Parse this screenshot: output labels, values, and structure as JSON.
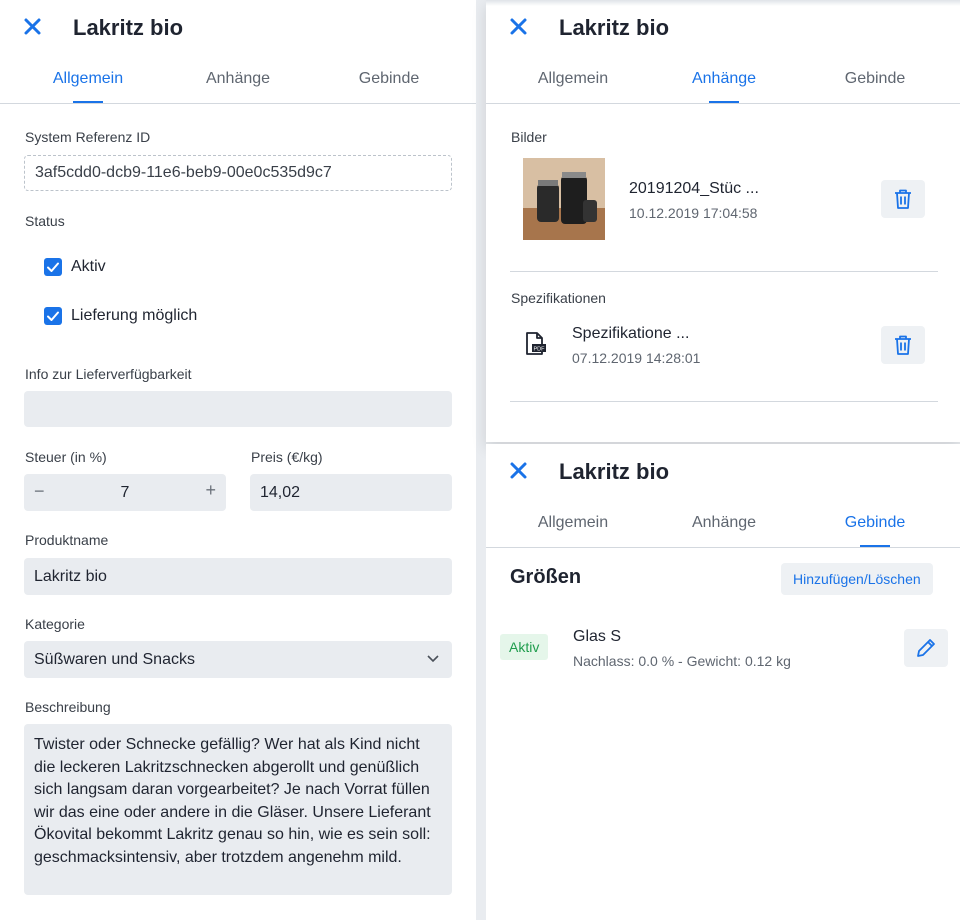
{
  "title": "Lakritz bio",
  "tabs": [
    "Allgemein",
    "Anhänge",
    "Gebinde"
  ],
  "general": {
    "ref_label": "System Referenz ID",
    "ref_value": "3af5cdd0-dcb9-11e6-beb9-00e0c535d9c7",
    "status_label": "Status",
    "status_active": "Aktiv",
    "status_delivery": "Lieferung möglich",
    "info_label": "Info zur Lieferverfügbarkeit",
    "info_value": "",
    "tax_label": "Steuer (in %)",
    "tax_value": "7",
    "price_label": "Preis (€/kg)",
    "price_value": "14,02",
    "name_label": "Produktname",
    "name_value": "Lakritz bio",
    "category_label": "Kategorie",
    "category_value": "Süßwaren und Snacks",
    "desc_label": "Beschreibung",
    "desc_value": "Twister oder Schnecke gefällig? Wer hat als Kind nicht die leckeren Lakritzschnecken abgerollt und genüßlich sich langsam daran vorgearbeitet? Je nach Vorrat füllen wir das eine oder andere in die Gläser. Unsere Lieferant Ökovital bekommt Lakritz genau so hin, wie es sein soll: geschmacksintensiv, aber trotzdem angenehm mild."
  },
  "attachments": {
    "images_label": "Bilder",
    "image": {
      "name": "20191204_Stüc ...",
      "date": "10.12.2019 17:04:58"
    },
    "specs_label": "Spezifikationen",
    "spec": {
      "name": "Spezifikatione ...",
      "date": "07.12.2019 14:28:01"
    }
  },
  "packaging": {
    "heading": "Größen",
    "add_label": "Hinzufügen/Löschen",
    "item": {
      "badge": "Aktiv",
      "name": "Glas S",
      "meta": "Nachlass: 0.0 % - Gewicht: 0.12 kg"
    }
  },
  "colors": {
    "accent": "#1a73e8",
    "success": "#1f9d4d"
  }
}
